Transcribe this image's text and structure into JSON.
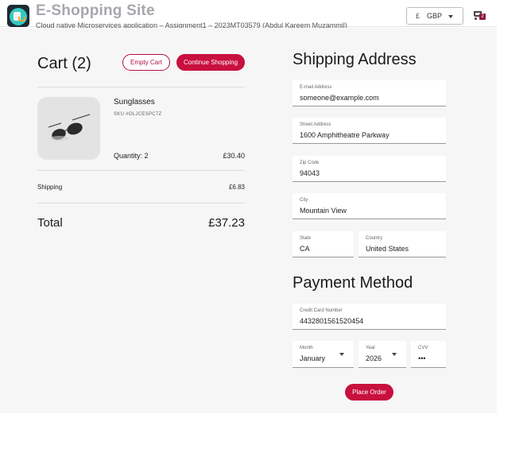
{
  "header": {
    "site_title": "E-Shopping Site",
    "subtitle": "Cloud native Microservices application – Assignment1 – 2023MT03579 (Abdul Kareem Muzammil)",
    "currency_symbol": "£",
    "currency_code": "GBP",
    "cart_count": "2"
  },
  "cart": {
    "title": "Cart (2)",
    "empty_label": "Empty Cart",
    "continue_label": "Continue Shopping",
    "item": {
      "name": "Sunglasses",
      "sku": "SKU #OLJCESPC7Z",
      "quantity": "Quantity: 2",
      "price": "£30.40"
    },
    "shipping_label": "Shipping",
    "shipping_value": "£6.83",
    "total_label": "Total",
    "total_value": "£37.23"
  },
  "shipping_address": {
    "title": "Shipping Address",
    "email_label": "E-mail Address",
    "email_value": "someone@example.com",
    "street_label": "Street Address",
    "street_value": "1600 Amphitheatre Parkway",
    "zip_label": "Zip Code",
    "zip_value": "94043",
    "city_label": "City",
    "city_value": "Mountain View",
    "state_label": "State",
    "state_value": "CA",
    "country_label": "Country",
    "country_value": "United States"
  },
  "payment": {
    "title": "Payment Method",
    "card_label": "Credit Card Number",
    "card_value": "4432801561520454",
    "month_label": "Month",
    "month_value": "January",
    "year_label": "Year",
    "year_value": "2026",
    "cvv_label": "CVV",
    "cvv_value": "•••",
    "place_order_label": "Place Order"
  },
  "colors": {
    "accent": "#c8103f",
    "background": "#f6f6f6"
  }
}
